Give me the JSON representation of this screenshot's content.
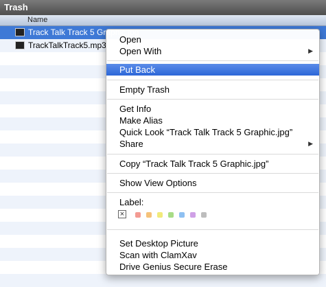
{
  "window": {
    "title": "Trash"
  },
  "columns": {
    "name": "Name"
  },
  "files": [
    {
      "name": "Track Talk Track 5 Graphic.jpg",
      "selected": true
    },
    {
      "name": "TrackTalkTrack5.mp3",
      "selected": false
    }
  ],
  "menu": {
    "open": "Open",
    "open_with": "Open With",
    "put_back": "Put Back",
    "empty_trash": "Empty Trash",
    "get_info": "Get Info",
    "make_alias": "Make Alias",
    "quick_look": "Quick Look “Track Talk Track 5 Graphic.jpg”",
    "share": "Share",
    "copy": "Copy “Track Talk Track 5 Graphic.jpg”",
    "show_view_options": "Show View Options",
    "label": "Label:",
    "label_colors": [
      "#f39b93",
      "#f5c27a",
      "#f1ea7b",
      "#a8dc86",
      "#8ec0f2",
      "#cfa0e6",
      "#bdbdbd"
    ],
    "set_desktop_picture": "Set Desktop Picture",
    "scan_clamxav": "Scan with ClamXav",
    "drive_genius": "Drive Genius Secure Erase"
  },
  "colors": {
    "highlight": "#3e79d6",
    "menu_highlight": "#2c67d8"
  }
}
